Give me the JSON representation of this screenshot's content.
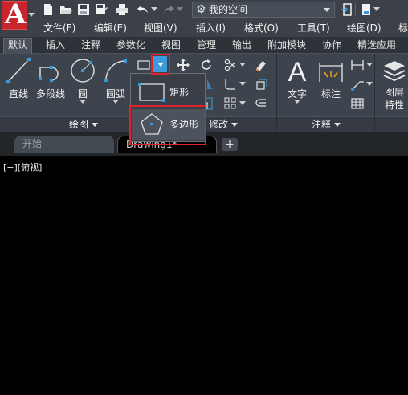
{
  "quick_access": {
    "workspace_label": "我的空间",
    "icons": [
      "new-icon",
      "open-icon",
      "save-icon",
      "save-as-icon",
      "print-icon",
      "undo-icon",
      "redo-icon",
      "gear-icon",
      "share-icon",
      "user-icon"
    ]
  },
  "menubar": {
    "items": [
      "文件(F)",
      "编辑(E)",
      "视图(V)",
      "插入(I)",
      "格式(O)",
      "工具(T)",
      "绘图(D)",
      "标"
    ]
  },
  "ribbon_tabs": [
    "默认",
    "插入",
    "注释",
    "参数化",
    "视图",
    "管理",
    "输出",
    "附加模块",
    "协作",
    "精选应用"
  ],
  "active_tab": "默认",
  "draw_panel": {
    "tools": {
      "line": "直线",
      "polyline": "多段线",
      "circle": "圆",
      "arc": "圆弧"
    },
    "title": "绘图"
  },
  "modify_panel": {
    "title": "修改"
  },
  "annotation_panel": {
    "tools": {
      "text": "文字",
      "dimension": "标注"
    },
    "title": "注释"
  },
  "layers_panel": {
    "label_line1": "图层",
    "label_line2": "特性"
  },
  "dropdown": {
    "items": [
      {
        "label": "矩形",
        "icon": "rectangle-icon"
      },
      {
        "label": "多边形",
        "icon": "polygon-icon"
      }
    ]
  },
  "doc_tabs": {
    "start": "开始",
    "drawing": "Drawing1*",
    "add": "+"
  },
  "viewport": {
    "label": "[−][俯视]"
  },
  "colors": {
    "highlight": "#e0202a",
    "brand": "#c8262c",
    "accent": "#3a9bdc"
  }
}
